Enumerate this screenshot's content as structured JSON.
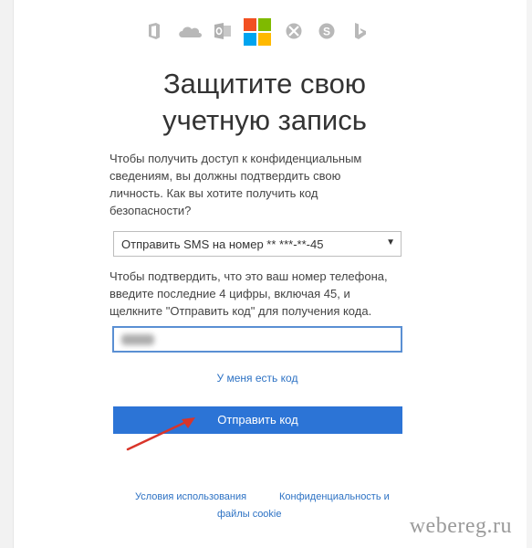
{
  "header": {
    "app_icons": [
      "office-icon",
      "onedrive-icon",
      "outlook-icon",
      "microsoft-logo-icon",
      "xbox-icon",
      "skype-icon",
      "bing-icon"
    ]
  },
  "page": {
    "title_line1": "Защитите свою",
    "title_line2": "учетную запись",
    "intro_line1": "Чтобы получить доступ к конфиденциальным",
    "intro_line2": "сведениям, вы должны подтвердить свою",
    "intro_line3": "личность. Как вы хотите получить код",
    "intro_line4": "безопасности?"
  },
  "method_select": {
    "selected": "Отправить SMS на номер ** ***-**-45",
    "arrow": "▼"
  },
  "instructions": {
    "line1": "Чтобы подтвердить, что это ваш номер телефона,",
    "line2": "введите последние 4 цифры, включая 45, и",
    "line3": "щелкните \"Отправить код\" для получения кода."
  },
  "links": {
    "have_code": "У меня есть код"
  },
  "actions": {
    "send_code": "Отправить код"
  },
  "footer": {
    "terms": "Условия использования",
    "privacy": "Конфиденциальность и",
    "cookie": "файлы cookie"
  },
  "watermark": "webereg.ru",
  "colors": {
    "accent": "#2c74d6",
    "link": "#2d72c4",
    "arrow": "#d9352a",
    "ms_red": "#f25022",
    "ms_green": "#7fba00",
    "ms_blue": "#00a4ef",
    "ms_yellow": "#ffb900"
  }
}
